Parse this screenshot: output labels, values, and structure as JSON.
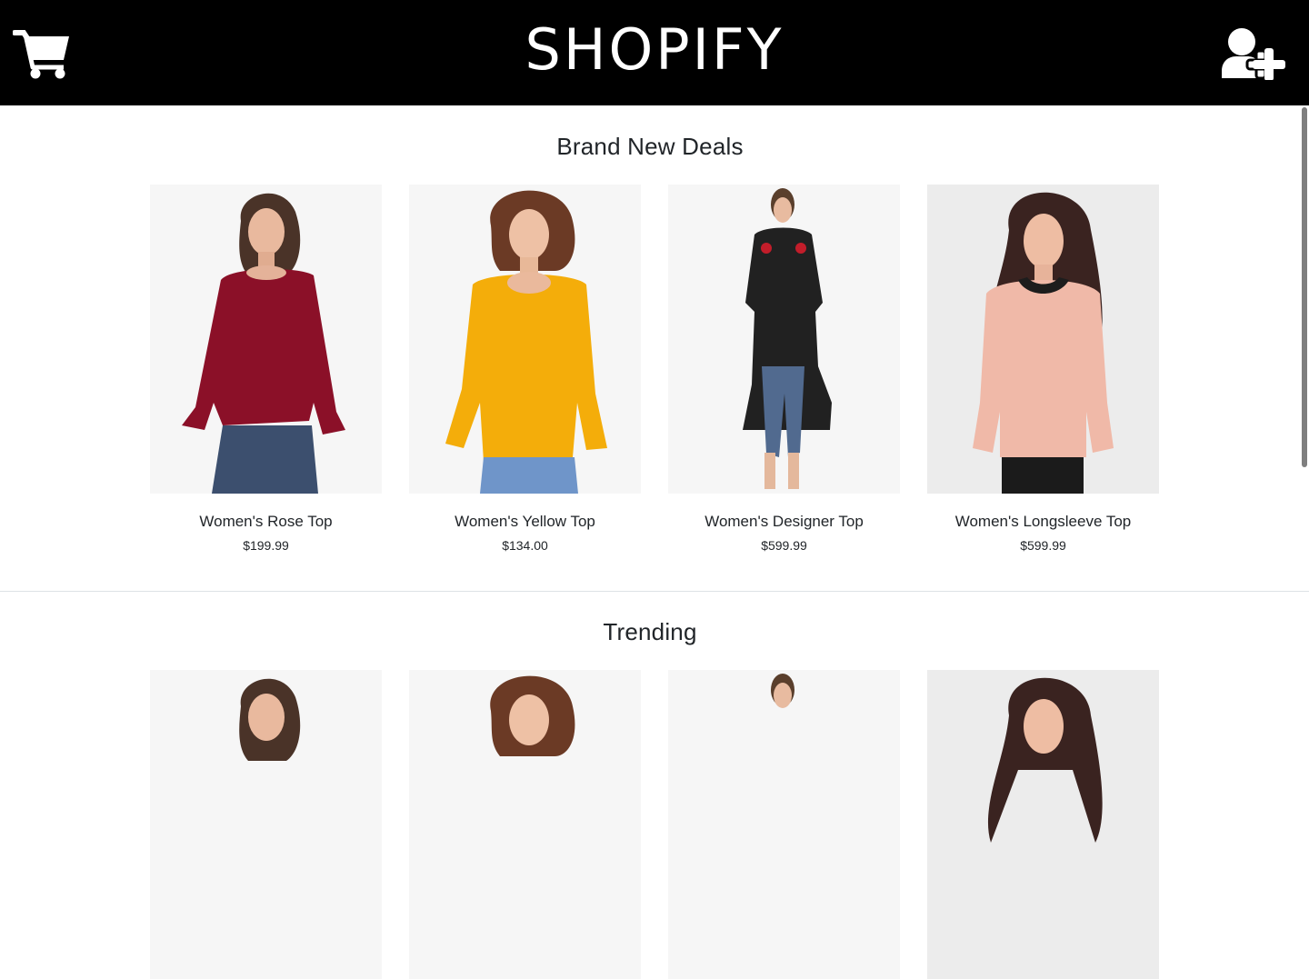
{
  "header": {
    "brand": "SHOPIFY",
    "cart_icon": "shopping-cart-icon",
    "user_add_icon": "user-plus-icon",
    "background": "#000000",
    "foreground": "#ffffff"
  },
  "sections": [
    {
      "title": "Brand New Deals",
      "products": [
        {
          "name": "Women's Rose Top",
          "price": "$199.99",
          "color": "#8b1028"
        },
        {
          "name": "Women's Yellow Top",
          "price": "$134.00",
          "color": "#f4ad0a"
        },
        {
          "name": "Women's Designer Top",
          "price": "$599.99",
          "color": "#151515"
        },
        {
          "name": "Women's Longsleeve Top",
          "price": "$599.99",
          "color": "#f0b9a8"
        }
      ]
    },
    {
      "title": "Trending",
      "products": [
        {
          "color": "#8b1028"
        },
        {
          "color": "#f4ad0a"
        },
        {
          "color": "#151515"
        },
        {
          "color": "#f0b9a8"
        }
      ]
    }
  ]
}
